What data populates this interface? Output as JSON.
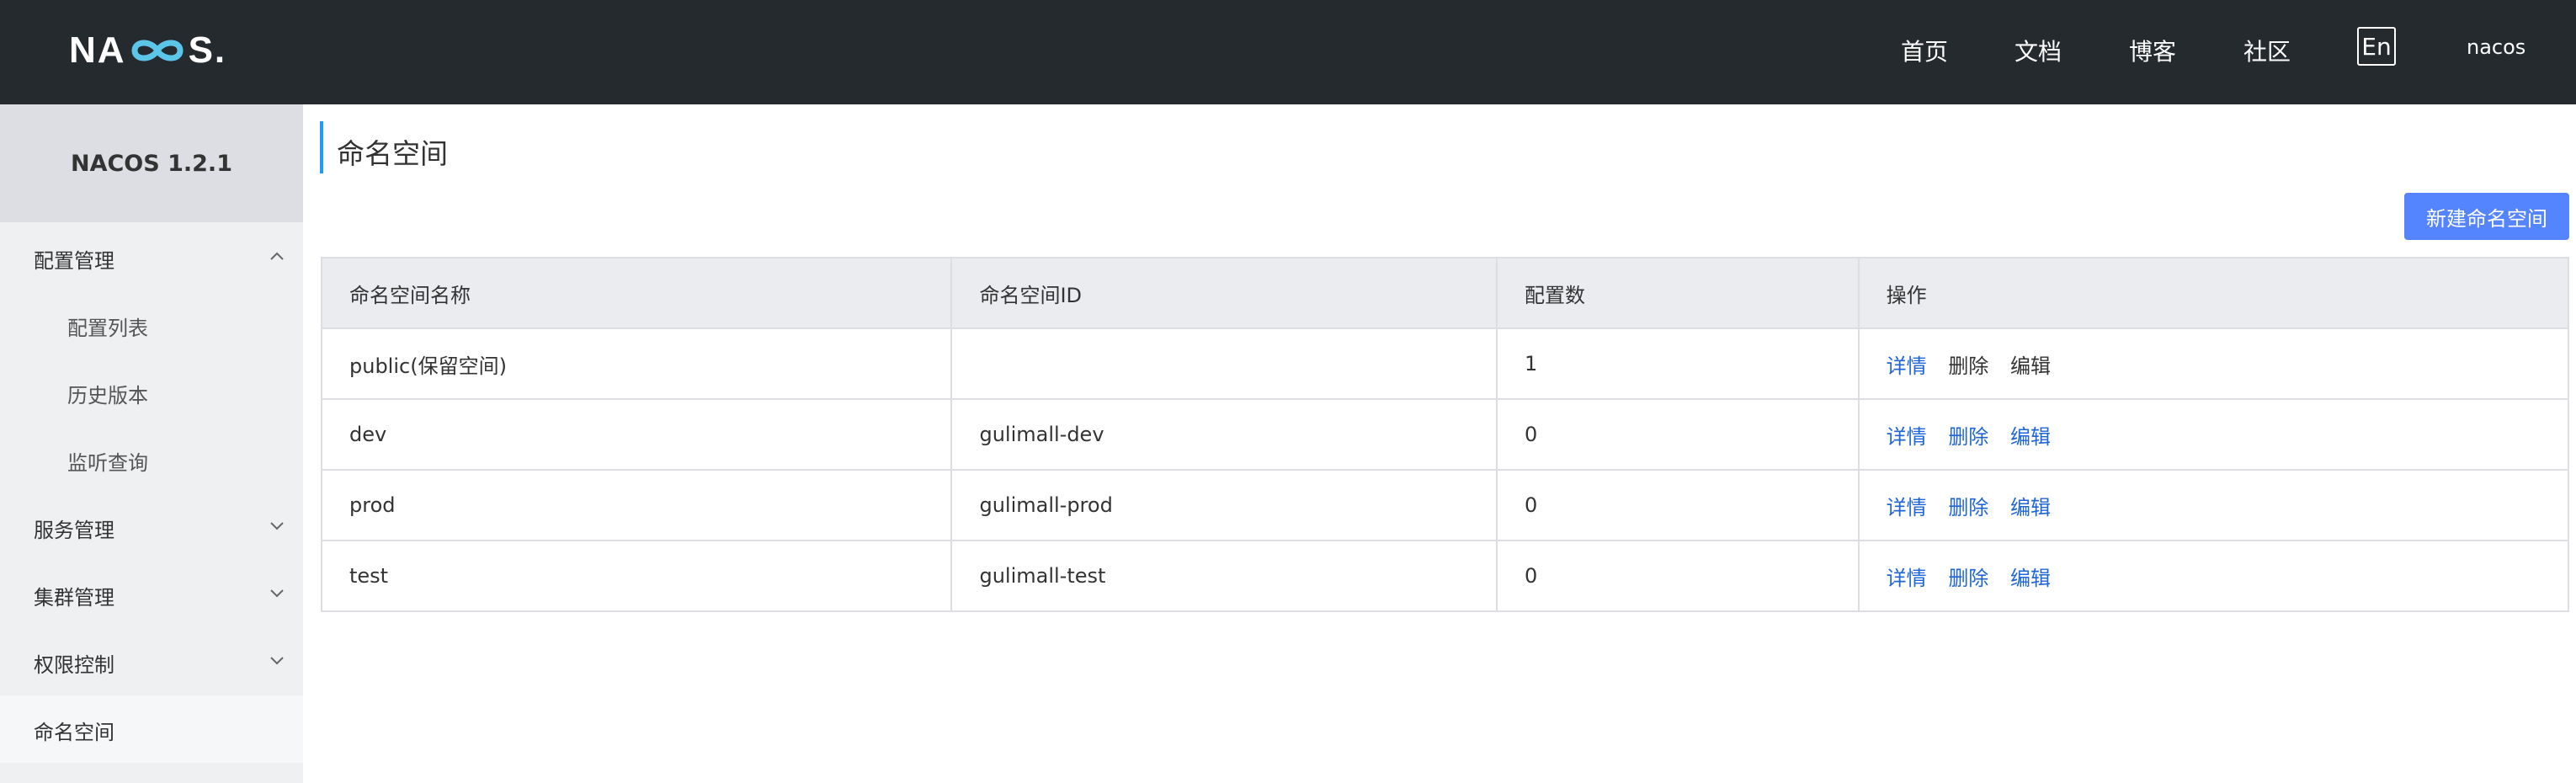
{
  "header": {
    "logo_text": "NACOS.",
    "nav": [
      "首页",
      "文档",
      "博客",
      "社区"
    ],
    "lang_button": "En",
    "user": "nacos"
  },
  "sidebar": {
    "title": "NACOS 1.2.1",
    "groups": [
      {
        "label": "配置管理",
        "expanded": true,
        "items": [
          "配置列表",
          "历史版本",
          "监听查询"
        ]
      },
      {
        "label": "服务管理",
        "expanded": false
      },
      {
        "label": "集群管理",
        "expanded": false
      },
      {
        "label": "权限控制",
        "expanded": false
      }
    ],
    "active_item": "命名空间"
  },
  "main": {
    "title": "命名空间",
    "new_button": "新建命名空间",
    "table": {
      "headers": [
        "命名空间名称",
        "命名空间ID",
        "配置数",
        "操作"
      ],
      "rows": [
        {
          "name": "public(保留空间)",
          "id": "",
          "count": "1",
          "ops": [
            "详情",
            "删除",
            "编辑"
          ]
        },
        {
          "name": "dev",
          "id": "gulimall-dev",
          "count": "0",
          "ops": [
            "详情",
            "删除",
            "编辑"
          ]
        },
        {
          "name": "prod",
          "id": "gulimall-prod",
          "count": "0",
          "ops": [
            "详情",
            "删除",
            "编辑"
          ]
        },
        {
          "name": "test",
          "id": "gulimall-test",
          "count": "0",
          "ops": [
            "详情",
            "删除",
            "编辑"
          ]
        }
      ]
    }
  },
  "colors": {
    "header_bg": "#252a2f",
    "accent": "#5584ff",
    "link": "#1f65d6",
    "sidebar_bg": "#eff0f2"
  }
}
